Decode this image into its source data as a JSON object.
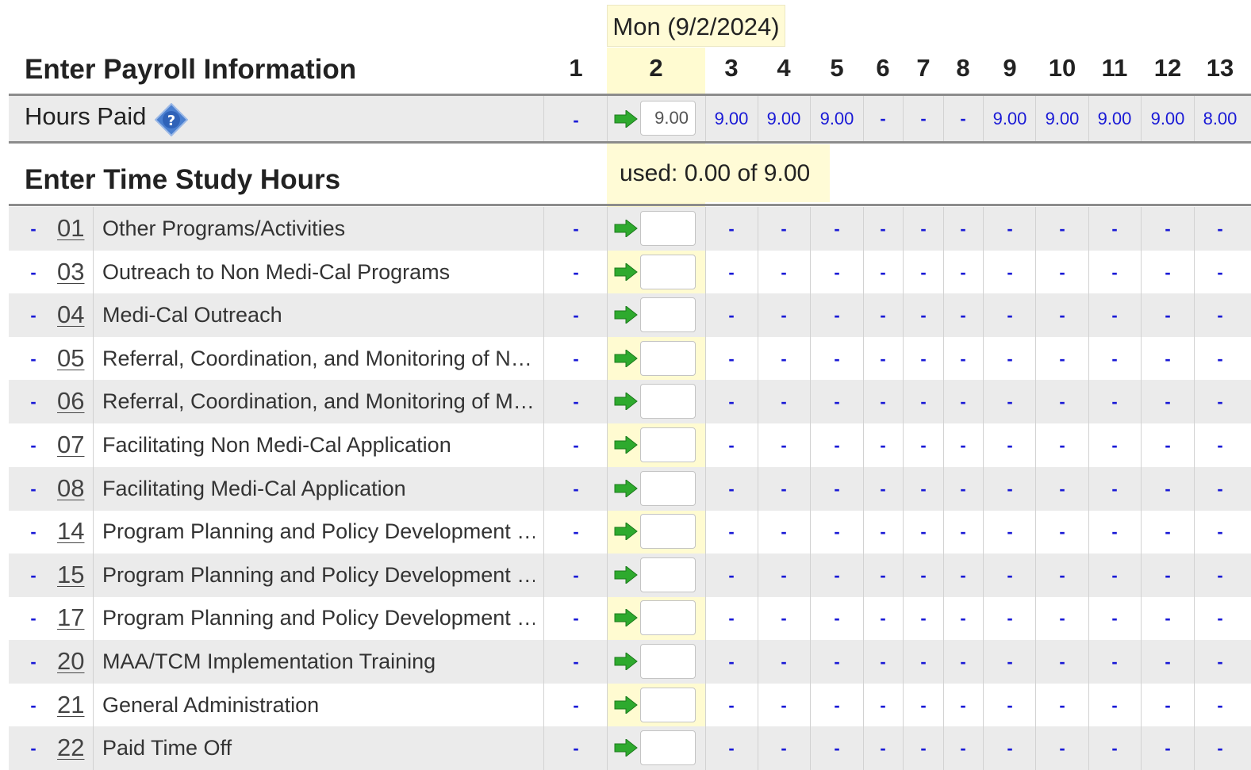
{
  "header": {
    "payroll_title": "Enter Payroll Information",
    "timestudy_title": "Enter Time Study Hours",
    "selected_day_tooltip": "Mon (9/2/2024)",
    "used_text": "used: 0.00 of 9.00"
  },
  "days": [
    "1",
    "2",
    "3",
    "4",
    "5",
    "6",
    "7",
    "8",
    "9",
    "10",
    "11",
    "12",
    "13"
  ],
  "hours_paid": {
    "label": "Hours Paid",
    "help_icon": "question-diamond-icon",
    "day1": "-",
    "input_value": "9.00",
    "values": [
      "9.00",
      "9.00",
      "9.00",
      "-",
      "-",
      "-",
      "9.00",
      "9.00",
      "9.00",
      "9.00",
      "8.00"
    ]
  },
  "activities": [
    {
      "code": "01",
      "name": "Other Programs/Activities"
    },
    {
      "code": "03",
      "name": "Outreach to Non Medi-Cal Programs"
    },
    {
      "code": "04",
      "name": "Medi-Cal Outreach"
    },
    {
      "code": "05",
      "name": "Referral, Coordination, and Monitoring of N…"
    },
    {
      "code": "06",
      "name": "Referral, Coordination, and Monitoring of M…"
    },
    {
      "code": "07",
      "name": "Facilitating Non Medi-Cal Application"
    },
    {
      "code": "08",
      "name": "Facilitating Medi-Cal Application"
    },
    {
      "code": "14",
      "name": "Program Planning and Policy Development …"
    },
    {
      "code": "15",
      "name": "Program Planning and Policy Development …"
    },
    {
      "code": "17",
      "name": "Program Planning and Policy Development …"
    },
    {
      "code": "20",
      "name": "MAA/TCM Implementation Training"
    },
    {
      "code": "21",
      "name": "General Administration"
    },
    {
      "code": "22",
      "name": "Paid Time Off"
    }
  ],
  "row_marker": "-",
  "empty_cell": "-",
  "colors": {
    "link": "#1a1ad6",
    "highlight": "#fffbd1",
    "arrow": "#2eaa2e",
    "row_shade": "#ebebeb"
  }
}
